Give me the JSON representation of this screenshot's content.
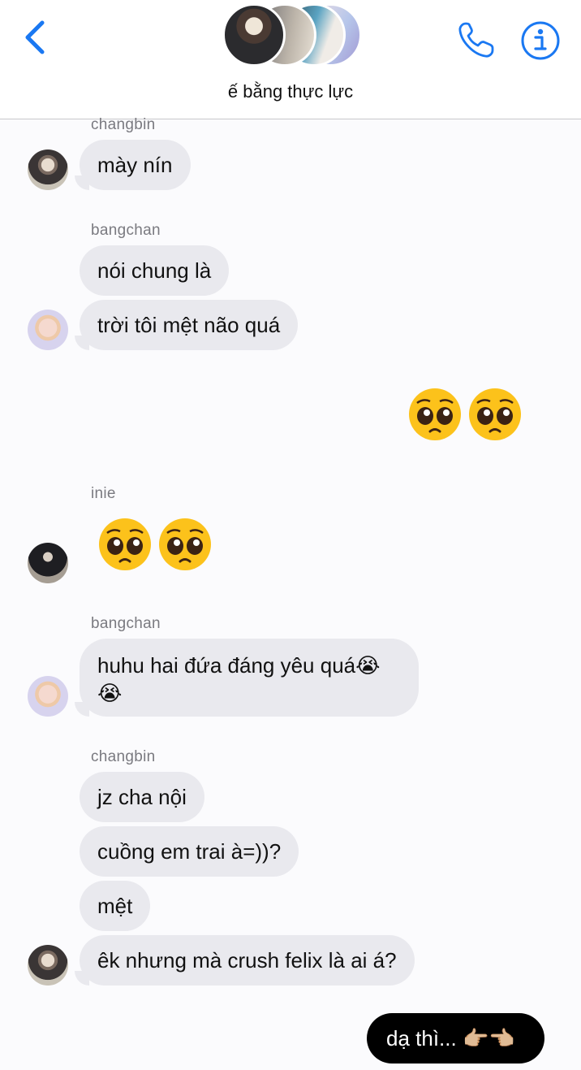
{
  "header": {
    "title": "ế bằng thực lực",
    "back_icon": "chevron-left-icon",
    "call_icon": "phone-icon",
    "info_icon": "info-icon",
    "accent_color": "#1a78f2"
  },
  "messages": [
    {
      "sender": "changbin",
      "text": "mày nín"
    },
    {
      "sender": "bangchan",
      "text_1": "nói chung là",
      "text_2": "trời tôi mệt não quá"
    },
    {
      "outgoing_emoji": "🥺🥺"
    },
    {
      "sender": "inie",
      "emoji": "🥺🥺"
    },
    {
      "sender": "bangchan",
      "text": "huhu hai đứa đáng yêu quá😭😭"
    },
    {
      "sender": "changbin",
      "texts": [
        "jz cha nội",
        "cuồng em trai à=))?",
        "mệt",
        "êk nhưng mà crush felix là ai á?"
      ]
    },
    {
      "outgoing_text": "dạ thì... 👉🏼👈🏼"
    }
  ],
  "bubble_colors": {
    "received": "#e9e9ee",
    "sent": "#000000"
  }
}
